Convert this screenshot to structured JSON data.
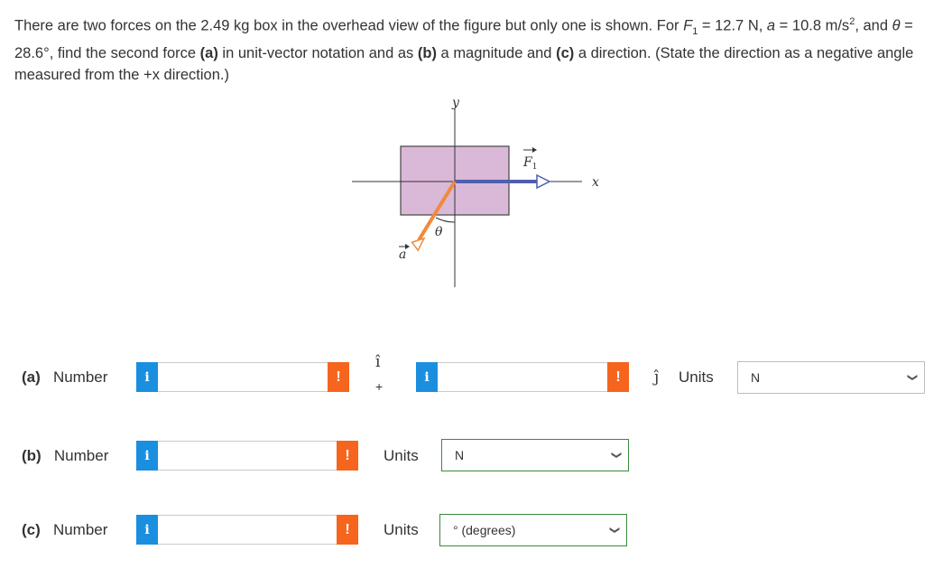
{
  "question": {
    "text_1": "There are two forces on the 2.49 kg box in the overhead view of the figure but only one is shown. For ",
    "f1_sym": "F",
    "f1_sub": "1",
    "text_2": " = 12.7 N, ",
    "a_sym": "a",
    "text_3": " = 10.8 m/s",
    "sq": "2",
    "text_4": ", and ",
    "theta_sym": "θ",
    "text_5": " = 28.6°, find the second force ",
    "pa": "(a)",
    "text_6": " in unit-vector notation and as ",
    "pb": "(b)",
    "text_7": " a magnitude and ",
    "pc": "(c)",
    "text_8": " a direction. (State the direction as a negative angle measured from the +",
    "x_sym": "x",
    "text_9": " direction.)"
  },
  "figure": {
    "y_label": "y",
    "x_label": "x",
    "f1_label": "F",
    "f1_sub": "1",
    "a_label": "a",
    "theta_label": "θ",
    "box_color": "#dab8d8",
    "f1_color": "#4f5fb0",
    "a_color": "#f08a3c"
  },
  "rows": {
    "a": {
      "part": "(a)",
      "label": "Number",
      "i_hat": "î",
      "plus": "+",
      "j_hat": "ĵ",
      "units_label": "Units",
      "unit_value": "N",
      "value_i": "",
      "value_j": ""
    },
    "b": {
      "part": "(b)",
      "label": "Number",
      "units_label": "Units",
      "unit_value": "N",
      "value": ""
    },
    "c": {
      "part": "(c)",
      "label": "Number",
      "units_label": "Units",
      "unit_value": "° (degrees)",
      "value": ""
    }
  },
  "icons": {
    "info": "i",
    "warning": "!",
    "chevron": "chevron-down-icon"
  }
}
